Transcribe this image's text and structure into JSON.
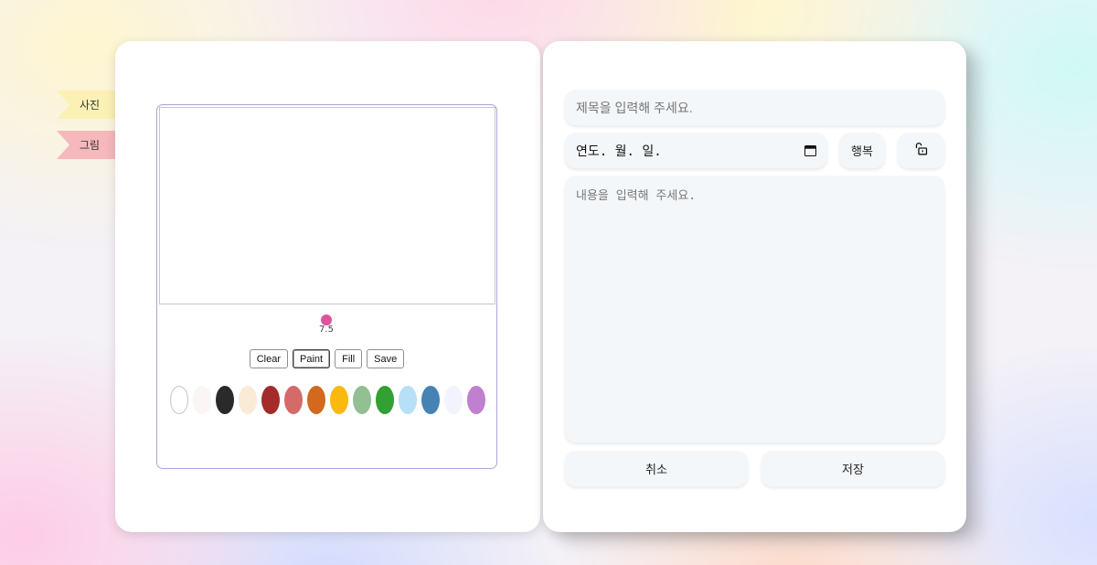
{
  "tabs": [
    {
      "label": "사진",
      "color": "#fbf1b4"
    },
    {
      "label": "그림",
      "color": "#f6b8bc"
    }
  ],
  "drawing": {
    "brush": {
      "size": "7.5",
      "color": "#e0529a"
    },
    "tools": [
      {
        "label": "Clear",
        "active": false
      },
      {
        "label": "Paint",
        "active": true
      },
      {
        "label": "Fill",
        "active": false
      },
      {
        "label": "Save",
        "active": false
      }
    ],
    "palette": [
      "#ffffff",
      "#fbf5f6",
      "#2a2a2a",
      "#faebd7",
      "#a52a2a",
      "#d46a6a",
      "#d2691e",
      "#fbb90f",
      "#93c093",
      "#32a032",
      "#b7e0f8",
      "#4682b4",
      "#f2f3fc",
      "#c07fcf"
    ]
  },
  "form": {
    "title_placeholder": "제목을 입력해 주세요.",
    "date_placeholder": "연도. 월. 일.",
    "emotion": "행복",
    "content_placeholder": "내용을 입력해 주세요.",
    "cancel_label": "취소",
    "save_label": "저장"
  }
}
